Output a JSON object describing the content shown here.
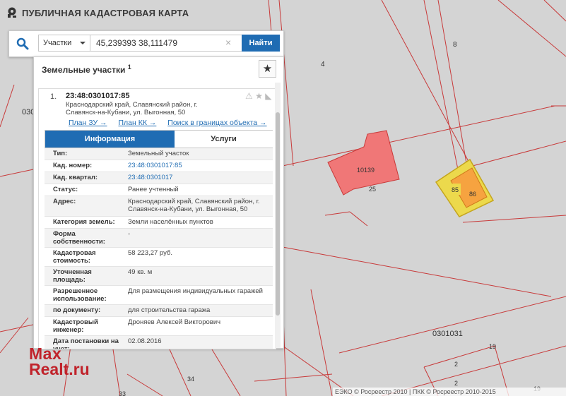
{
  "app": {
    "title": "ПУБЛИЧНАЯ КАДАСТРОВАЯ КАРТА",
    "logo_icon": "map-pin-icon"
  },
  "search": {
    "type_selected": "Участки",
    "query": "45,239393 38,111479",
    "find_label": "Найти"
  },
  "panel": {
    "title": "Земельные участки",
    "count": "1",
    "result": {
      "number": "1.",
      "cad_number": "23:48:0301017:85",
      "address": "Краснодарский край, Славянский район, г. Славянск-на-Кубани, ул. Выгонная, 50",
      "links": [
        "План ЗУ →",
        "План КК →",
        "Поиск в границах объекта →"
      ]
    },
    "tabs": [
      "Информация",
      "Услуги"
    ],
    "info": [
      {
        "k": "Тип:",
        "v": "Земельный участок"
      },
      {
        "k": "Кад. номер:",
        "v": "23:48:0301017:85"
      },
      {
        "k": "Кад. квартал:",
        "v": "23:48:0301017"
      },
      {
        "k": "Статус:",
        "v": "Ранее учтенный"
      },
      {
        "k": "Адрес:",
        "v": "Краснодарский край, Славянский район, г. Славянск-на-Кубани, ул. Выгонная, 50"
      },
      {
        "k": "Категория земель:",
        "v": "Земли населённых пунктов"
      },
      {
        "k": "Форма собственности:",
        "v": "-"
      },
      {
        "k": "Кадастровая стоимость:",
        "v": "58 223,27 руб."
      },
      {
        "k": "Уточненная площадь:",
        "v": "49 кв. м"
      },
      {
        "k": "Разрешенное использование:",
        "v": "Для размещения индивидуальных гаражей"
      },
      {
        "k": "по документу:",
        "v": "для строительства гаража"
      },
      {
        "k": "Кадастровый инженер:",
        "v": "Дроняев Алексей Викторович"
      },
      {
        "k": "Дата постановки на учет:",
        "v": "02.08.2016"
      }
    ]
  },
  "map": {
    "labels": [
      "8",
      "4",
      "030",
      "10139",
      "25",
      "85",
      "86",
      "0301031",
      "19",
      "2",
      "2",
      "34",
      "19",
      "33"
    ],
    "colors": {
      "parcel_red": "#f07777",
      "parcel_yellow": "#ecd94c",
      "parcel_orange": "#f6a340",
      "lines": "#c83a3a"
    }
  },
  "watermark": {
    "line1": "Max",
    "line2": "Realt.ru"
  },
  "attribution": "ЕЭКО © Росреестр 2010 | ПКК © Росреестр 2010-2015"
}
